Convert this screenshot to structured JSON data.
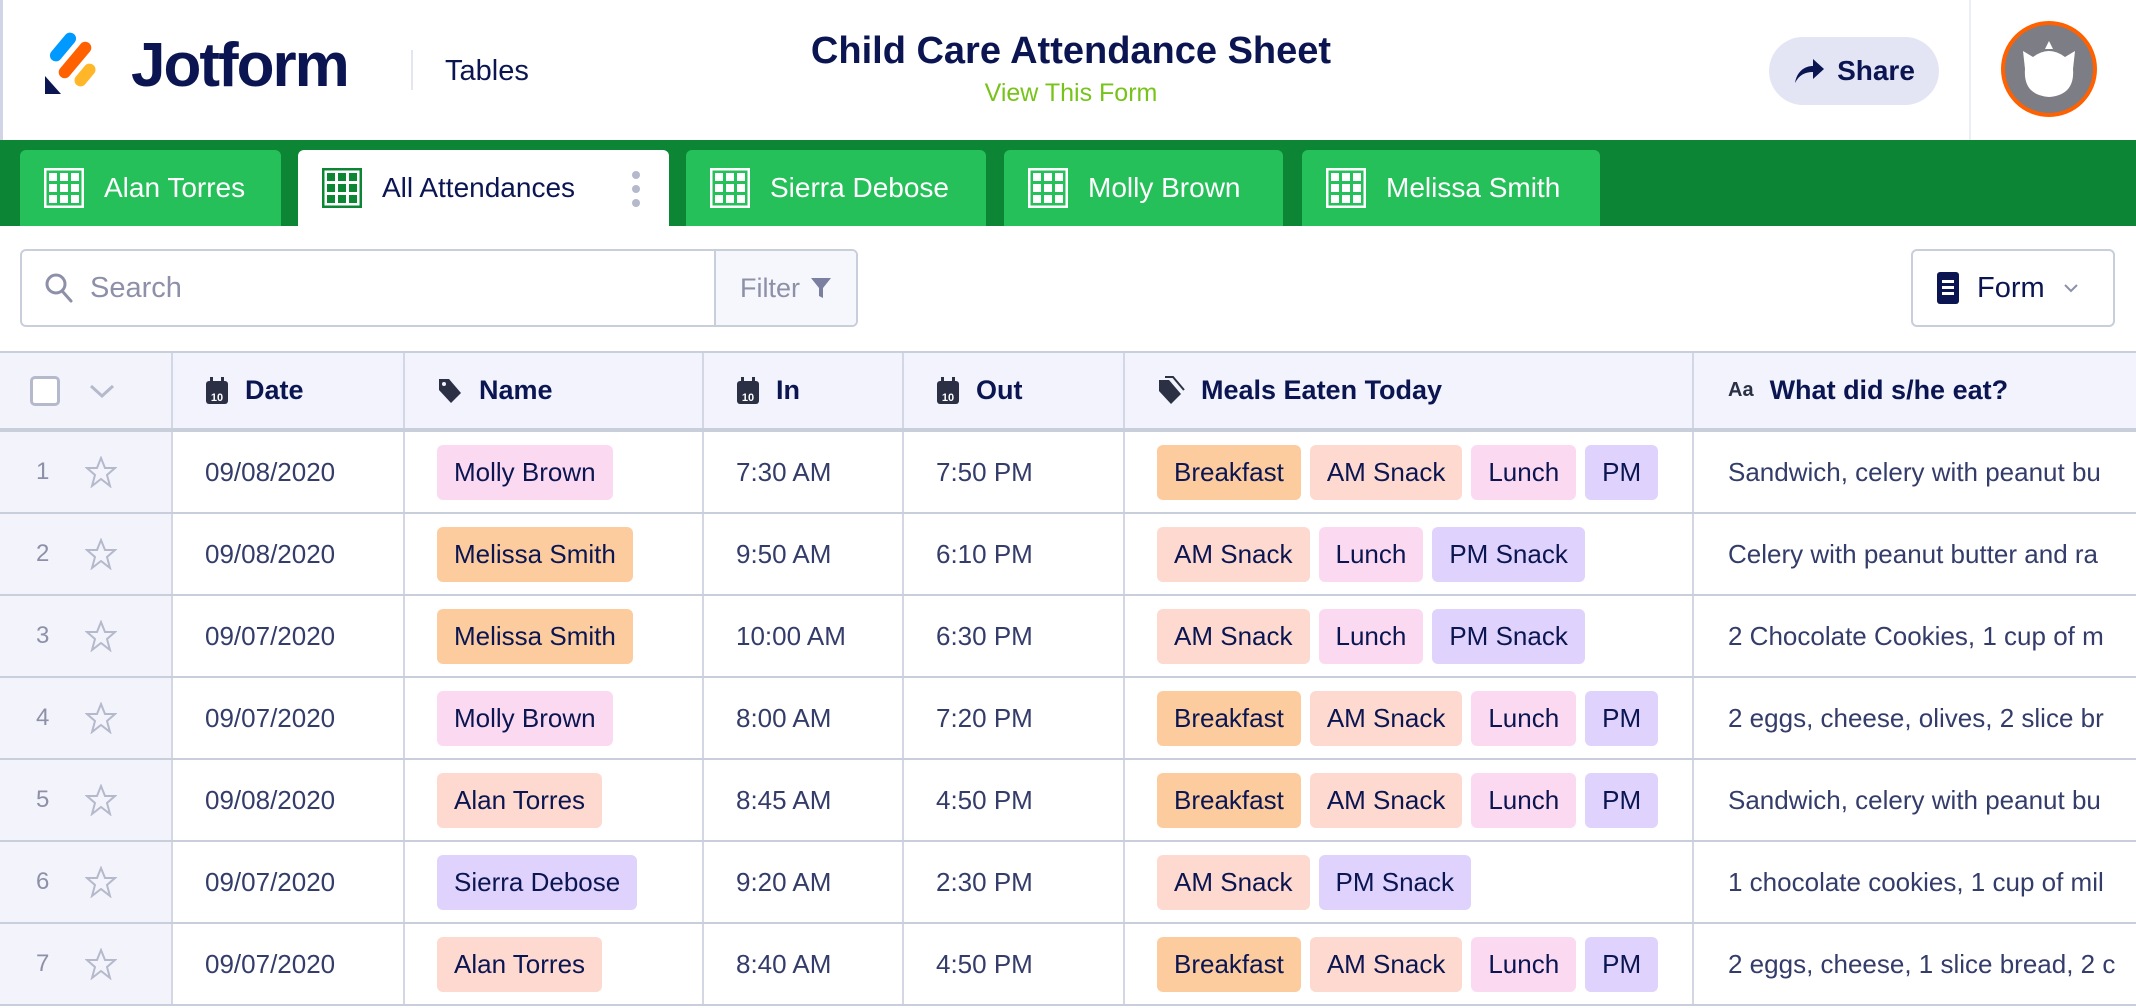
{
  "header": {
    "brand": "Jotform",
    "section": "Tables",
    "title": "Child Care Attendance Sheet",
    "view_form_link": "View This Form",
    "share_label": "Share"
  },
  "tabs": [
    {
      "label": "Alan Torres",
      "active": false
    },
    {
      "label": "All Attendances",
      "active": true
    },
    {
      "label": "Sierra Debose",
      "active": false
    },
    {
      "label": "Molly Brown",
      "active": false
    },
    {
      "label": "Melissa Smith",
      "active": false
    }
  ],
  "toolbar": {
    "search_placeholder": "Search",
    "filter_label": "Filter",
    "form_label": "Form"
  },
  "columns": [
    {
      "label": "Date",
      "icon": "calendar-icon"
    },
    {
      "label": "Name",
      "icon": "tag-icon"
    },
    {
      "label": "In",
      "icon": "calendar-icon"
    },
    {
      "label": "Out",
      "icon": "calendar-icon"
    },
    {
      "label": "Meals Eaten Today",
      "icon": "tags-icon"
    },
    {
      "label": "What did s/he eat?",
      "icon": "text-icon"
    }
  ],
  "colors": {
    "tab_bar": "#0c8535",
    "tab": "#26c05a",
    "link": "#78c31a",
    "Breakfast": "#fccc9f",
    "AM Snack": "#fdd9cf",
    "Lunch": "#fbdaf1",
    "PM Snack": "#dfd2fc",
    "PM": "#dfd2fc",
    "Molly Brown": "#fbdaf1",
    "Melissa Smith": "#fccc9f",
    "Alan Torres": "#fdd9cf",
    "Sierra Debose": "#dfd2fc"
  },
  "rows": [
    {
      "num": "1",
      "date": "09/08/2020",
      "name": "Molly Brown",
      "in": "7:30 AM",
      "out": "7:50 PM",
      "meals": [
        "Breakfast",
        "AM Snack",
        "Lunch",
        "PM"
      ],
      "ate": "Sandwich, celery with peanut bu"
    },
    {
      "num": "2",
      "date": "09/08/2020",
      "name": "Melissa Smith",
      "in": "9:50 AM",
      "out": "6:10 PM",
      "meals": [
        "AM Snack",
        "Lunch",
        "PM Snack"
      ],
      "ate": "Celery with peanut butter and ra"
    },
    {
      "num": "3",
      "date": "09/07/2020",
      "name": "Melissa Smith",
      "in": "10:00 AM",
      "out": "6:30 PM",
      "meals": [
        "AM Snack",
        "Lunch",
        "PM Snack"
      ],
      "ate": "2 Chocolate Cookies, 1 cup of m"
    },
    {
      "num": "4",
      "date": "09/07/2020",
      "name": "Molly Brown",
      "in": "8:00 AM",
      "out": "7:20 PM",
      "meals": [
        "Breakfast",
        "AM Snack",
        "Lunch",
        "PM"
      ],
      "ate": "2 eggs, cheese, olives, 2 slice br"
    },
    {
      "num": "5",
      "date": "09/08/2020",
      "name": "Alan Torres",
      "in": "8:45 AM",
      "out": "4:50 PM",
      "meals": [
        "Breakfast",
        "AM Snack",
        "Lunch",
        "PM"
      ],
      "ate": "Sandwich, celery with peanut bu"
    },
    {
      "num": "6",
      "date": "09/07/2020",
      "name": "Sierra Debose",
      "in": "9:20 AM",
      "out": "2:30 PM",
      "meals": [
        "AM Snack",
        "PM Snack"
      ],
      "ate": "1 chocolate cookies, 1 cup of mil"
    },
    {
      "num": "7",
      "date": "09/07/2020",
      "name": "Alan Torres",
      "in": "8:40 AM",
      "out": "4:50 PM",
      "meals": [
        "Breakfast",
        "AM Snack",
        "Lunch",
        "PM"
      ],
      "ate": "2 eggs, cheese, 1 slice bread, 2 c"
    }
  ]
}
